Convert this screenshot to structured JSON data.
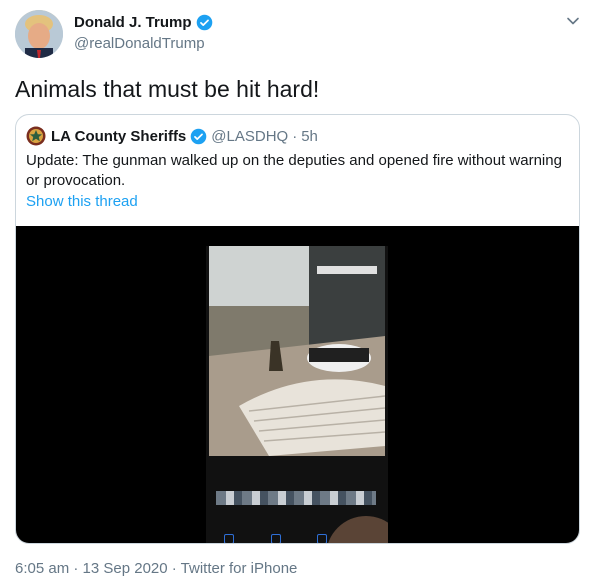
{
  "author": {
    "display_name": "Donald J. Trump",
    "handle": "@realDonaldTrump",
    "verified": true
  },
  "tweet": {
    "text": "Animals that must be hit hard!"
  },
  "quote": {
    "display_name": "LA County Sheriffs",
    "handle": "@LASDHQ",
    "separator": "·",
    "time": "5h",
    "text": "Update: The gunman walked up on the deputies and opened fire without warning or provocation.",
    "thread_link": "Show this thread"
  },
  "meta": {
    "line": "6:05 am · 13 Sep 2020 · Twitter for iPhone"
  },
  "colors": {
    "link": "#1da1f2",
    "muted": "#657786",
    "verified": "#1da1f2"
  },
  "icons": [
    "verified-badge-icon",
    "chevron-down-icon",
    "sheriff-star-logo"
  ]
}
